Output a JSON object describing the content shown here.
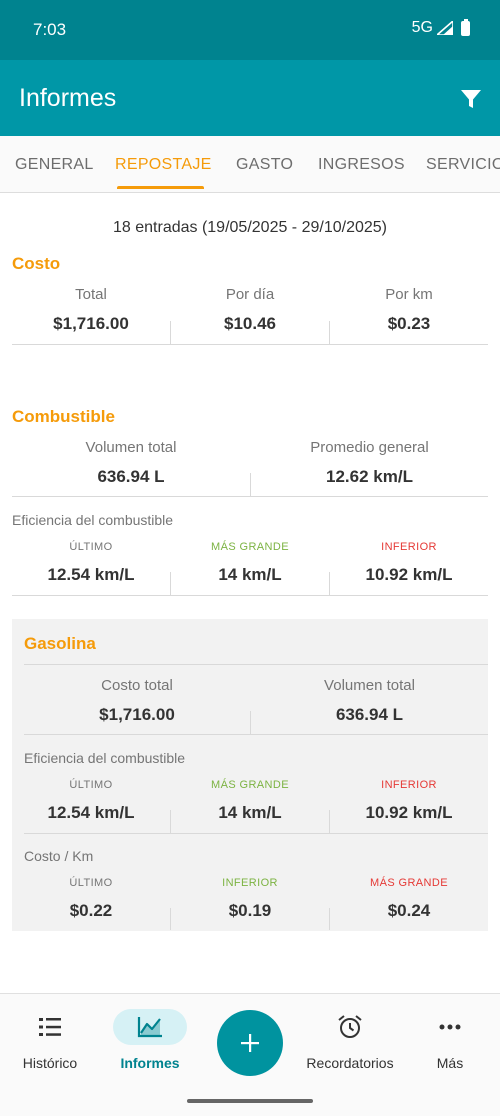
{
  "status_bar": {
    "time": "7:03",
    "network": "5G"
  },
  "app_bar": {
    "title": "Informes"
  },
  "tabs": [
    {
      "label": "GENERAL"
    },
    {
      "label": "REPOSTAJE"
    },
    {
      "label": "GASTO"
    },
    {
      "label": "INGRESOS"
    },
    {
      "label": "SERVICIO"
    }
  ],
  "active_tab": "REPOSTAJE",
  "summary": {
    "entries": "18 entradas (19/05/2025 - 29/10/2025)"
  },
  "costo": {
    "title": "Costo",
    "stats": [
      {
        "label": "Total",
        "value": "$1,716.00"
      },
      {
        "label": "Por día",
        "value": "$10.46"
      },
      {
        "label": "Por km",
        "value": "$0.23"
      }
    ]
  },
  "combustible": {
    "title": "Combustible",
    "stats": [
      {
        "label": "Volumen total",
        "value": "636.94 L"
      },
      {
        "label": "Promedio general",
        "value": "12.62 km/L"
      }
    ],
    "efficiency": {
      "title": "Eficiencia del combustible",
      "stats": [
        {
          "label": "ÚLTIMO",
          "value": "12.54 km/L"
        },
        {
          "label": "MÁS GRANDE",
          "value": "14 km/L"
        },
        {
          "label": "INFERIOR",
          "value": "10.92 km/L"
        }
      ]
    }
  },
  "gasolina": {
    "title": "Gasolina",
    "stats": [
      {
        "label": "Costo total",
        "value": "$1,716.00"
      },
      {
        "label": "Volumen total",
        "value": "636.94 L"
      }
    ],
    "efficiency": {
      "title": "Eficiencia del combustible",
      "stats": [
        {
          "label": "ÚLTIMO",
          "value": "12.54 km/L"
        },
        {
          "label": "MÁS GRANDE",
          "value": "14 km/L"
        },
        {
          "label": "INFERIOR",
          "value": "10.92 km/L"
        }
      ]
    },
    "cost_per_km": {
      "title": "Costo / Km",
      "stats": [
        {
          "label": "ÚLTIMO",
          "value": "$0.22"
        },
        {
          "label": "INFERIOR",
          "value": "$0.19"
        },
        {
          "label": "MÁS GRANDE",
          "value": "$0.24"
        }
      ]
    }
  },
  "bottom_nav": {
    "items": [
      {
        "label": "Histórico",
        "icon": "list-icon"
      },
      {
        "label": "Informes",
        "icon": "chart-icon"
      },
      {
        "label": "Recordatorios",
        "icon": "alarm-clock-icon"
      },
      {
        "label": "Más",
        "icon": "more-horizontal-icon"
      }
    ],
    "fab_icon": "plus-icon"
  },
  "colors": {
    "status_bar": "#00838f",
    "app_bar": "#0097a7",
    "accent": "#f59b0a",
    "green_label": "#7cb342",
    "red_label": "#e53935",
    "fab": "#00939f"
  }
}
